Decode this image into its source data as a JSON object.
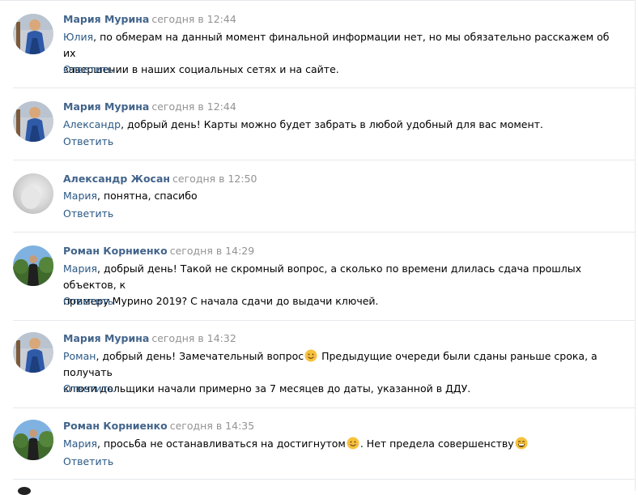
{
  "comments": [
    {
      "author": "Мария Мурина",
      "date": "сегодня в 12:44",
      "mention": "Юлия",
      "text_line1": ", по обмерам на данный момент финальной информации нет, но мы обязательно расскажем об их",
      "text_line2": "завершении в наших социальных сетях и на сайте.",
      "reply": "Ответить"
    },
    {
      "author": "Мария Мурина",
      "date": "сегодня в 12:44",
      "mention": "Александр",
      "text_line1": ", добрый день! Карты можно будет забрать в любой удобный для вас момент.",
      "reply": "Ответить"
    },
    {
      "author": "Александр Жосан",
      "date": "сегодня в 12:50",
      "mention": "Мария",
      "text_line1": ", понятна, спасибо",
      "reply": "Ответить"
    },
    {
      "author": "Роман Корниенко",
      "date": "сегодня в 14:29",
      "mention": "Мария",
      "text_line1": ", добрый день! Такой не скромный вопрос, а сколько по времени длилась сдача прошлых объектов, к",
      "text_line2": "примеру Мурино 2019? С начала сдачи до выдачи ключей.",
      "reply": "Ответить"
    },
    {
      "author": "Мария Мурина",
      "date": "сегодня в 14:32",
      "mention": "Роман",
      "text_part_a": ", добрый день! Замечательный вопрос",
      "text_part_b": " Предыдущие очереди были сданы раньше срока, а получать",
      "text_line2": "ключи дольщики начали примерно за 7 месяцев до даты, указанной в ДДУ.",
      "emoji_1": "smile-emoji",
      "reply": "Ответить"
    },
    {
      "author": "Роман Корниенко",
      "date": "сегодня в 14:35",
      "mention": "Мария",
      "text_part_a": ", просьба не останавливаться на достигнутом",
      "text_part_b": ". Нет предела совершенству",
      "emoji_1": "smile-emoji",
      "emoji_2": "grin-emoji",
      "reply": "Ответить"
    }
  ],
  "colors": {
    "author": "#42648b",
    "link": "#2a5885",
    "date": "#939393",
    "divider": "#e7e8ec",
    "emoji": "#f7c23b"
  }
}
